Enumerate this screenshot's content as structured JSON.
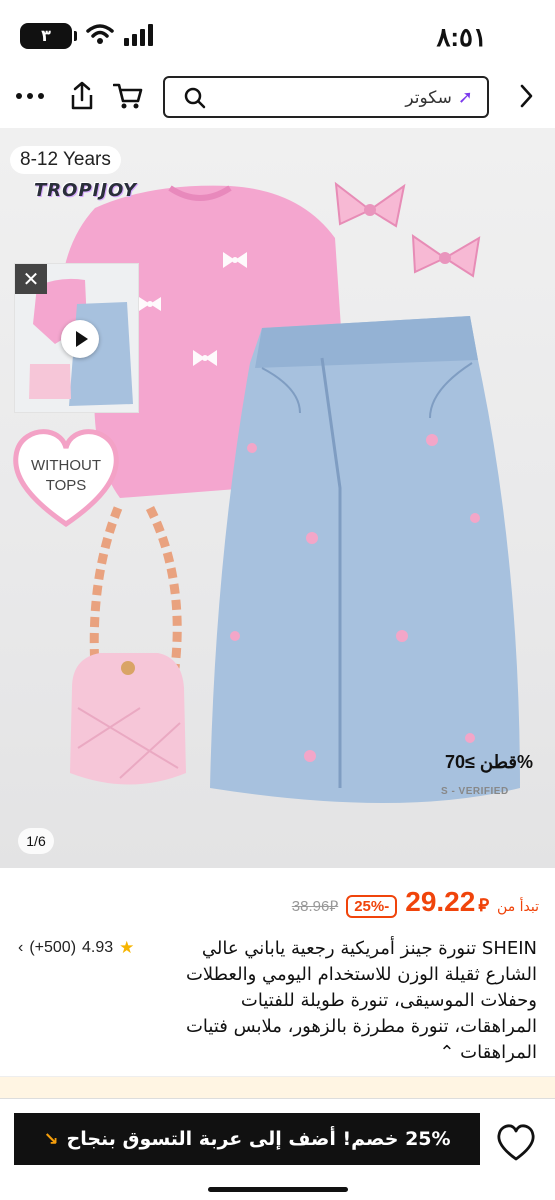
{
  "status_bar": {
    "time": "٨:٥١",
    "battery": "٣"
  },
  "header": {
    "search_term": "سكوتر"
  },
  "gallery": {
    "age_label": "8-12 Years",
    "brand": "TROPIJOY",
    "without_tops": [
      "WITHOUT",
      "TOPS"
    ],
    "thumb_without_tops": "WITHOUT TOPS",
    "cotton": "%قطن ≥70",
    "verified": "S - VERIFIED",
    "page_counter": "1/6"
  },
  "product": {
    "from_label": "تبدأ من",
    "price": "29.22",
    "currency": "⃁",
    "discount": "-25%",
    "old_price": "38.96⃁",
    "rating": "4.93",
    "review_count": "(+500)",
    "title": "SHEIN تنورة جينز أمريكية رجعية ياباني عالي الشارع ثقيلة الوزن للاستخدام اليومي والعطلات وحفلات الموسيقى، تنورة طويلة للفتيات المراهقات، تنورة مطرزة بالزهور، ملابس فتيات المراهقات ⌃"
  },
  "bottom_bar": {
    "cta": "25% خصم! أضف إلى عربة التسوق بنجاح",
    "cta_arrow": "↘"
  },
  "colors": {
    "accent": "#f0440b",
    "button": "#111111",
    "star": "#f6b400"
  }
}
